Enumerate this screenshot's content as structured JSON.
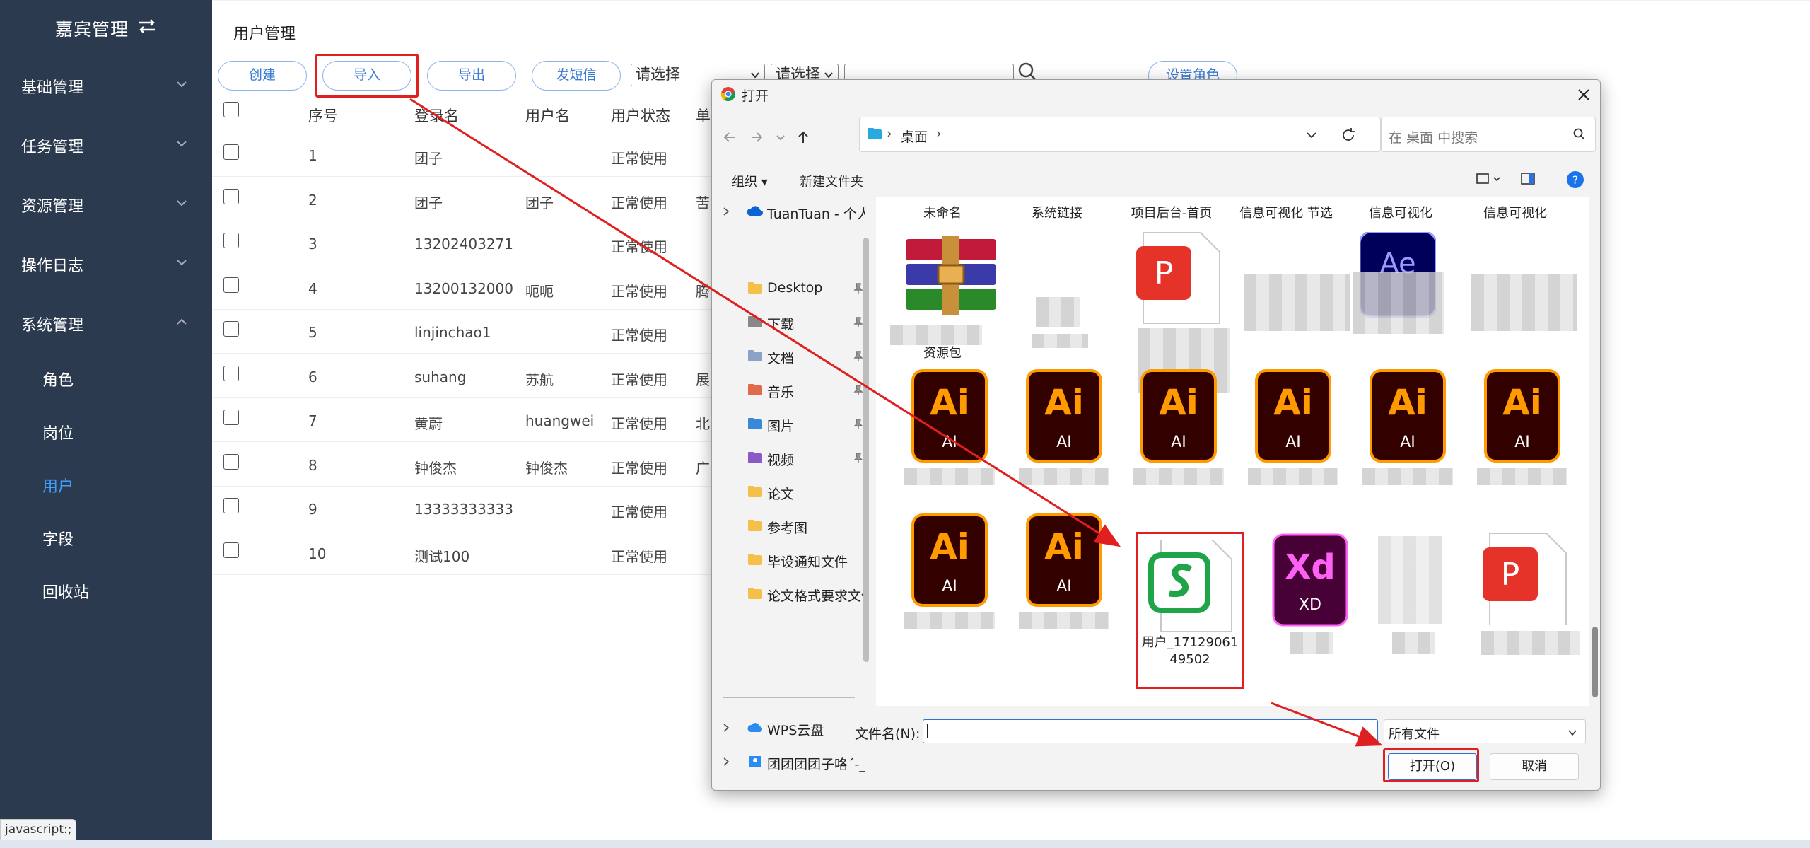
{
  "sidebar": {
    "title": "嘉宾管理",
    "menus": [
      {
        "label": "基础管理"
      },
      {
        "label": "任务管理"
      },
      {
        "label": "资源管理"
      },
      {
        "label": "操作日志"
      },
      {
        "label": "系统管理"
      }
    ],
    "submenu": [
      {
        "label": "角色"
      },
      {
        "label": "岗位"
      },
      {
        "label": "用户",
        "active": true
      },
      {
        "label": "字段"
      },
      {
        "label": "回收站"
      }
    ]
  },
  "main": {
    "page_title": "用户管理",
    "toolbar": {
      "create": "创建",
      "import": "导入",
      "export": "导出",
      "sms": "发短信",
      "select1": "请选择",
      "select2": "请选择",
      "set_role": "设置角色"
    },
    "table": {
      "headers": [
        "序号",
        "登录名",
        "用户名",
        "用户状态",
        "单"
      ],
      "rows": [
        {
          "no": "1",
          "login": "团子",
          "name": "",
          "status": "正常使用",
          "unit": ""
        },
        {
          "no": "2",
          "login": "团子",
          "name": "团子",
          "status": "正常使用",
          "unit": "苦"
        },
        {
          "no": "3",
          "login": "13202403271",
          "name": "",
          "status": "正常使用",
          "unit": ""
        },
        {
          "no": "4",
          "login": "13200132000",
          "name": "呃呃",
          "status": "正常使用",
          "unit": "腾"
        },
        {
          "no": "5",
          "login": "linjinchao1",
          "name": "",
          "status": "正常使用",
          "unit": ""
        },
        {
          "no": "6",
          "login": "suhang",
          "name": "苏航",
          "status": "正常使用",
          "unit": "展"
        },
        {
          "no": "7",
          "login": "黄蔚",
          "name": "huangwei",
          "status": "正常使用",
          "unit": "北"
        },
        {
          "no": "8",
          "login": "钟俊杰",
          "name": "钟俊杰",
          "status": "正常使用",
          "unit": "广"
        },
        {
          "no": "9",
          "login": "13333333333",
          "name": "",
          "status": "正常使用",
          "unit": ""
        },
        {
          "no": "10",
          "login": "测试100",
          "name": "",
          "status": "正常使用",
          "unit": ""
        }
      ]
    }
  },
  "status_tip": "javascript:;",
  "dialog": {
    "title": "打开",
    "breadcrumb": "桌面",
    "search_placeholder": "在 桌面 中搜索",
    "organize": "组织 ▾",
    "new_folder": "新建文件夹",
    "nav": {
      "onedrive": "TuanTuan - 个人",
      "items": [
        "Desktop",
        "下载",
        "文档",
        "音乐",
        "图片",
        "视频",
        "论文",
        "参考图",
        "毕设通知文件",
        "论文格式要求文件"
      ],
      "wps": "WPS云盘",
      "more": "团团团团子咯´-_"
    },
    "files_row0": [
      "未命名",
      "系统链接",
      "项目后台-首页",
      "信息可视化 节选",
      "信息可视化",
      "信息可视化"
    ],
    "files_row1_name": "资源包",
    "ai_label": "AI",
    "ai_glyph": "Ai",
    "xd_label": "XD",
    "xd_glyph": "Xd",
    "selected_file": "用户_1712906149502",
    "filename_label": "文件名(N):",
    "filename_value": "",
    "filter": "所有文件",
    "open_button": "打开(O)",
    "cancel_button": "取消"
  },
  "colors": {
    "sidebar_bg": "#2b3a4f",
    "active": "#409eff",
    "highlight": "#e02020",
    "ai_bg": "#330000",
    "ai_fg": "#ff9a00",
    "xd_bg": "#470137",
    "xd_fg": "#ff61f6"
  }
}
